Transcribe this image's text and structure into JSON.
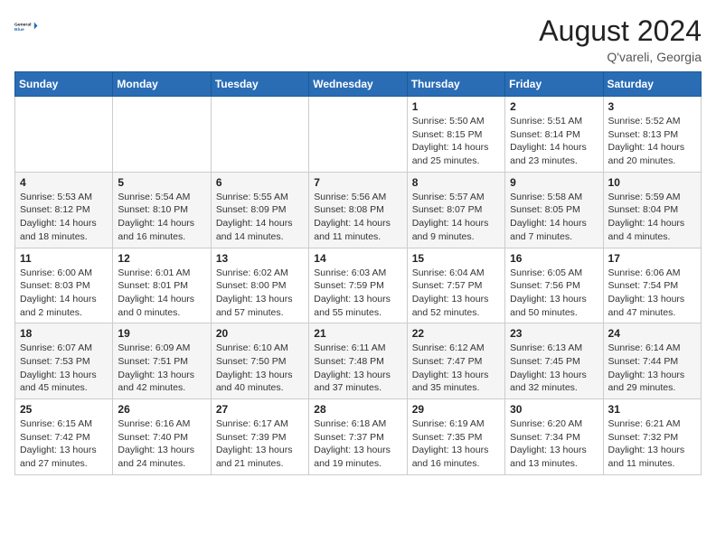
{
  "logo": {
    "line1": "General",
    "line2": "Blue"
  },
  "title": "August 2024",
  "location": "Q'vareli, Georgia",
  "days_of_week": [
    "Sunday",
    "Monday",
    "Tuesday",
    "Wednesday",
    "Thursday",
    "Friday",
    "Saturday"
  ],
  "weeks": [
    [
      {
        "day": "",
        "info": ""
      },
      {
        "day": "",
        "info": ""
      },
      {
        "day": "",
        "info": ""
      },
      {
        "day": "",
        "info": ""
      },
      {
        "day": "1",
        "info": "Sunrise: 5:50 AM\nSunset: 8:15 PM\nDaylight: 14 hours\nand 25 minutes."
      },
      {
        "day": "2",
        "info": "Sunrise: 5:51 AM\nSunset: 8:14 PM\nDaylight: 14 hours\nand 23 minutes."
      },
      {
        "day": "3",
        "info": "Sunrise: 5:52 AM\nSunset: 8:13 PM\nDaylight: 14 hours\nand 20 minutes."
      }
    ],
    [
      {
        "day": "4",
        "info": "Sunrise: 5:53 AM\nSunset: 8:12 PM\nDaylight: 14 hours\nand 18 minutes."
      },
      {
        "day": "5",
        "info": "Sunrise: 5:54 AM\nSunset: 8:10 PM\nDaylight: 14 hours\nand 16 minutes."
      },
      {
        "day": "6",
        "info": "Sunrise: 5:55 AM\nSunset: 8:09 PM\nDaylight: 14 hours\nand 14 minutes."
      },
      {
        "day": "7",
        "info": "Sunrise: 5:56 AM\nSunset: 8:08 PM\nDaylight: 14 hours\nand 11 minutes."
      },
      {
        "day": "8",
        "info": "Sunrise: 5:57 AM\nSunset: 8:07 PM\nDaylight: 14 hours\nand 9 minutes."
      },
      {
        "day": "9",
        "info": "Sunrise: 5:58 AM\nSunset: 8:05 PM\nDaylight: 14 hours\nand 7 minutes."
      },
      {
        "day": "10",
        "info": "Sunrise: 5:59 AM\nSunset: 8:04 PM\nDaylight: 14 hours\nand 4 minutes."
      }
    ],
    [
      {
        "day": "11",
        "info": "Sunrise: 6:00 AM\nSunset: 8:03 PM\nDaylight: 14 hours\nand 2 minutes."
      },
      {
        "day": "12",
        "info": "Sunrise: 6:01 AM\nSunset: 8:01 PM\nDaylight: 14 hours\nand 0 minutes."
      },
      {
        "day": "13",
        "info": "Sunrise: 6:02 AM\nSunset: 8:00 PM\nDaylight: 13 hours\nand 57 minutes."
      },
      {
        "day": "14",
        "info": "Sunrise: 6:03 AM\nSunset: 7:59 PM\nDaylight: 13 hours\nand 55 minutes."
      },
      {
        "day": "15",
        "info": "Sunrise: 6:04 AM\nSunset: 7:57 PM\nDaylight: 13 hours\nand 52 minutes."
      },
      {
        "day": "16",
        "info": "Sunrise: 6:05 AM\nSunset: 7:56 PM\nDaylight: 13 hours\nand 50 minutes."
      },
      {
        "day": "17",
        "info": "Sunrise: 6:06 AM\nSunset: 7:54 PM\nDaylight: 13 hours\nand 47 minutes."
      }
    ],
    [
      {
        "day": "18",
        "info": "Sunrise: 6:07 AM\nSunset: 7:53 PM\nDaylight: 13 hours\nand 45 minutes."
      },
      {
        "day": "19",
        "info": "Sunrise: 6:09 AM\nSunset: 7:51 PM\nDaylight: 13 hours\nand 42 minutes."
      },
      {
        "day": "20",
        "info": "Sunrise: 6:10 AM\nSunset: 7:50 PM\nDaylight: 13 hours\nand 40 minutes."
      },
      {
        "day": "21",
        "info": "Sunrise: 6:11 AM\nSunset: 7:48 PM\nDaylight: 13 hours\nand 37 minutes."
      },
      {
        "day": "22",
        "info": "Sunrise: 6:12 AM\nSunset: 7:47 PM\nDaylight: 13 hours\nand 35 minutes."
      },
      {
        "day": "23",
        "info": "Sunrise: 6:13 AM\nSunset: 7:45 PM\nDaylight: 13 hours\nand 32 minutes."
      },
      {
        "day": "24",
        "info": "Sunrise: 6:14 AM\nSunset: 7:44 PM\nDaylight: 13 hours\nand 29 minutes."
      }
    ],
    [
      {
        "day": "25",
        "info": "Sunrise: 6:15 AM\nSunset: 7:42 PM\nDaylight: 13 hours\nand 27 minutes."
      },
      {
        "day": "26",
        "info": "Sunrise: 6:16 AM\nSunset: 7:40 PM\nDaylight: 13 hours\nand 24 minutes."
      },
      {
        "day": "27",
        "info": "Sunrise: 6:17 AM\nSunset: 7:39 PM\nDaylight: 13 hours\nand 21 minutes."
      },
      {
        "day": "28",
        "info": "Sunrise: 6:18 AM\nSunset: 7:37 PM\nDaylight: 13 hours\nand 19 minutes."
      },
      {
        "day": "29",
        "info": "Sunrise: 6:19 AM\nSunset: 7:35 PM\nDaylight: 13 hours\nand 16 minutes."
      },
      {
        "day": "30",
        "info": "Sunrise: 6:20 AM\nSunset: 7:34 PM\nDaylight: 13 hours\nand 13 minutes."
      },
      {
        "day": "31",
        "info": "Sunrise: 6:21 AM\nSunset: 7:32 PM\nDaylight: 13 hours\nand 11 minutes."
      }
    ]
  ]
}
